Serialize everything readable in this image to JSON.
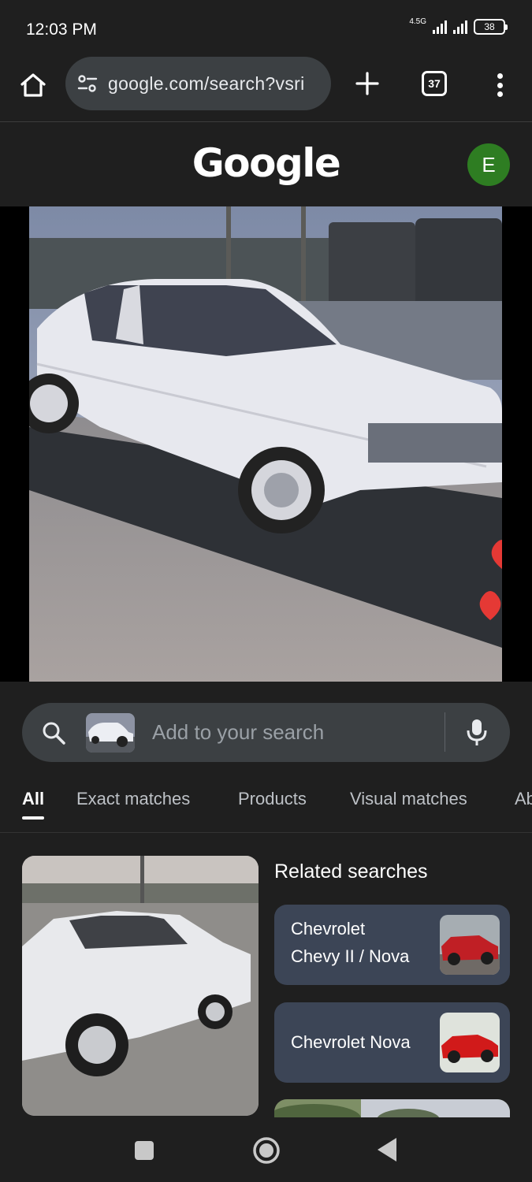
{
  "status_bar": {
    "time": "12:03 PM",
    "network": "4.5G",
    "battery": "38"
  },
  "browser": {
    "url": "google.com/search?vsri",
    "tab_count": "37",
    "icons": [
      "home-icon",
      "site-settings-icon",
      "new-tab-icon",
      "tab-switcher-icon",
      "more-menu-icon"
    ]
  },
  "header": {
    "logo": "Google",
    "avatar_letter": "E",
    "avatar_color": "#2e7d22"
  },
  "search": {
    "placeholder": "Add to your search"
  },
  "tabs": [
    {
      "label": "All",
      "active": true
    },
    {
      "label": "Exact matches",
      "active": false
    },
    {
      "label": "Products",
      "active": false
    },
    {
      "label": "Visual matches",
      "active": false
    },
    {
      "label": "Ab",
      "active": false
    }
  ],
  "related": {
    "title": "Related searches",
    "items": [
      {
        "line1": "Chevrolet",
        "line2": "Chevy II / Nova"
      },
      {
        "line1": "Chevrolet Nova"
      }
    ]
  },
  "colors": {
    "background": "#1f1f1f",
    "pill": "#3c4043",
    "card": "#3c4556"
  }
}
